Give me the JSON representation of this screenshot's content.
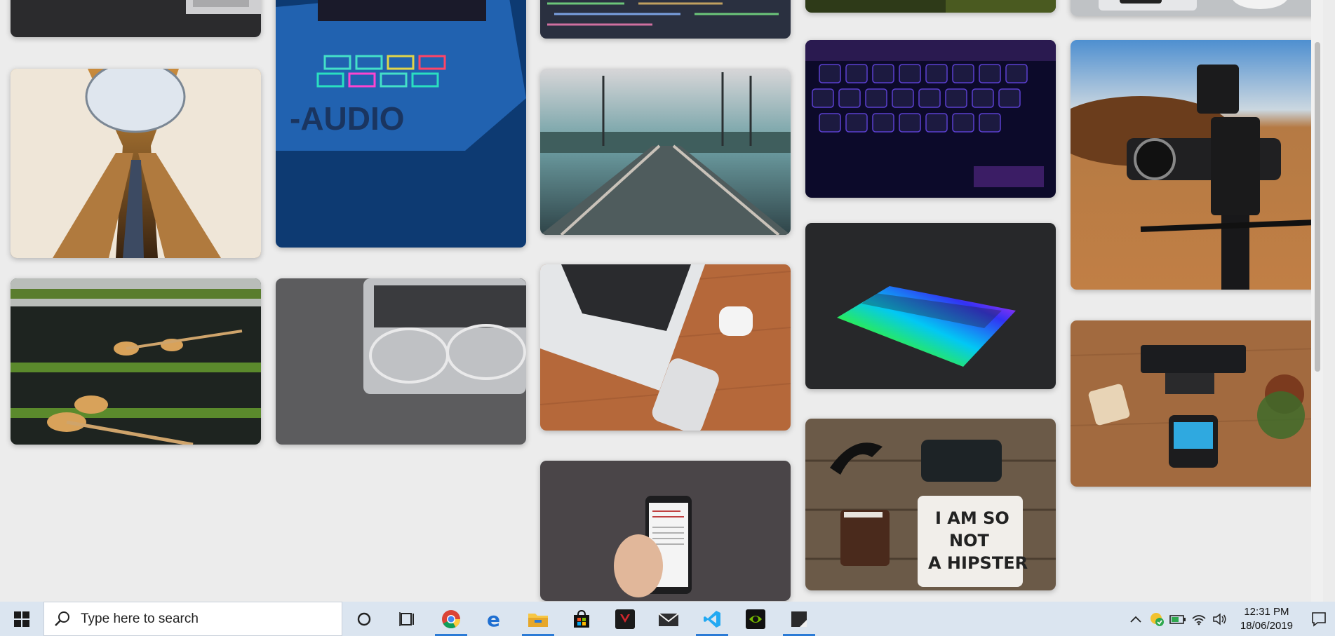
{
  "gallery": {
    "photos": [
      "stylus-on-laptop",
      "escalators",
      "m-audio-pad-controller",
      "bamboo-water-fountain",
      "glasses-on-laptop",
      "code-on-screen",
      "railway-tracks",
      "laptop-airpods-iphone",
      "hand-holding-phone",
      "forest-top",
      "rgb-keyboard",
      "rainbow-laptop-keyboard",
      "i-am-so-not-a-hipster-flatlay",
      "devices-top",
      "cinema-camera-rig",
      "payment-terminal"
    ]
  },
  "taskbar": {
    "search_placeholder": "Type here to search",
    "apps": [
      "cortana",
      "task-view",
      "chrome",
      "edge",
      "file-explorer",
      "microsoft-store",
      "predator-sense",
      "mail",
      "visual-studio-code",
      "nvidia",
      "sticky-notes"
    ],
    "active_apps": [
      "chrome",
      "file-explorer",
      "visual-studio-code",
      "sticky-notes"
    ],
    "time": "12:31 PM",
    "date": "18/06/2019"
  },
  "colors": {
    "taskbar_bg": "#dbe5f0",
    "accent": "#2b7bd6",
    "page_bg": "#ececec"
  }
}
